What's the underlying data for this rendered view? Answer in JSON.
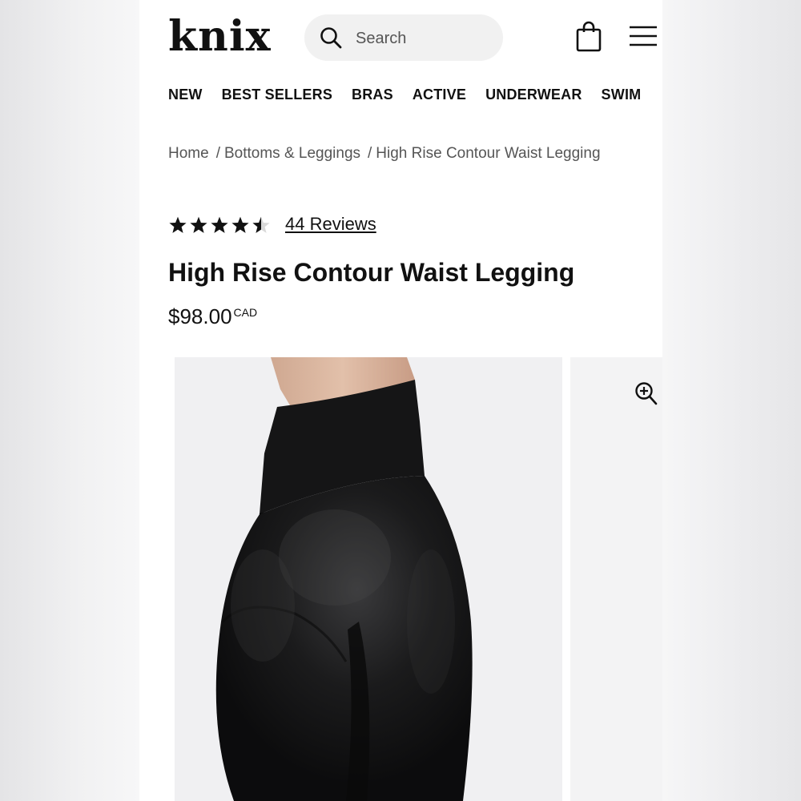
{
  "brand": {
    "logo_text": "knix"
  },
  "search": {
    "placeholder": "Search"
  },
  "icons": {
    "search": "search-icon",
    "cart": "shopping-bag-icon",
    "menu": "hamburger-menu-icon",
    "zoom": "zoom-in-icon",
    "rating": "star-icon"
  },
  "nav": {
    "items": [
      {
        "label": "NEW"
      },
      {
        "label": "BEST SELLERS"
      },
      {
        "label": "BRAS"
      },
      {
        "label": "ACTIVE"
      },
      {
        "label": "UNDERWEAR"
      },
      {
        "label": "SWIM"
      }
    ]
  },
  "breadcrumb": {
    "items": [
      {
        "label": "Home"
      },
      {
        "label": "Bottoms & Leggings"
      },
      {
        "label": "High Rise Contour Waist Legging"
      }
    ],
    "separator": "/"
  },
  "product": {
    "rating_value": 4.5,
    "rating_max": 5,
    "reviews_label": "44 Reviews",
    "title": "High Rise Contour Waist Legging",
    "price": "$98.00",
    "currency": "CAD"
  },
  "colors": {
    "text": "#111111",
    "muted": "#555555",
    "search_bg": "#f1f1f1",
    "image_bg": "#f0f0f2",
    "legging": "#121212"
  }
}
